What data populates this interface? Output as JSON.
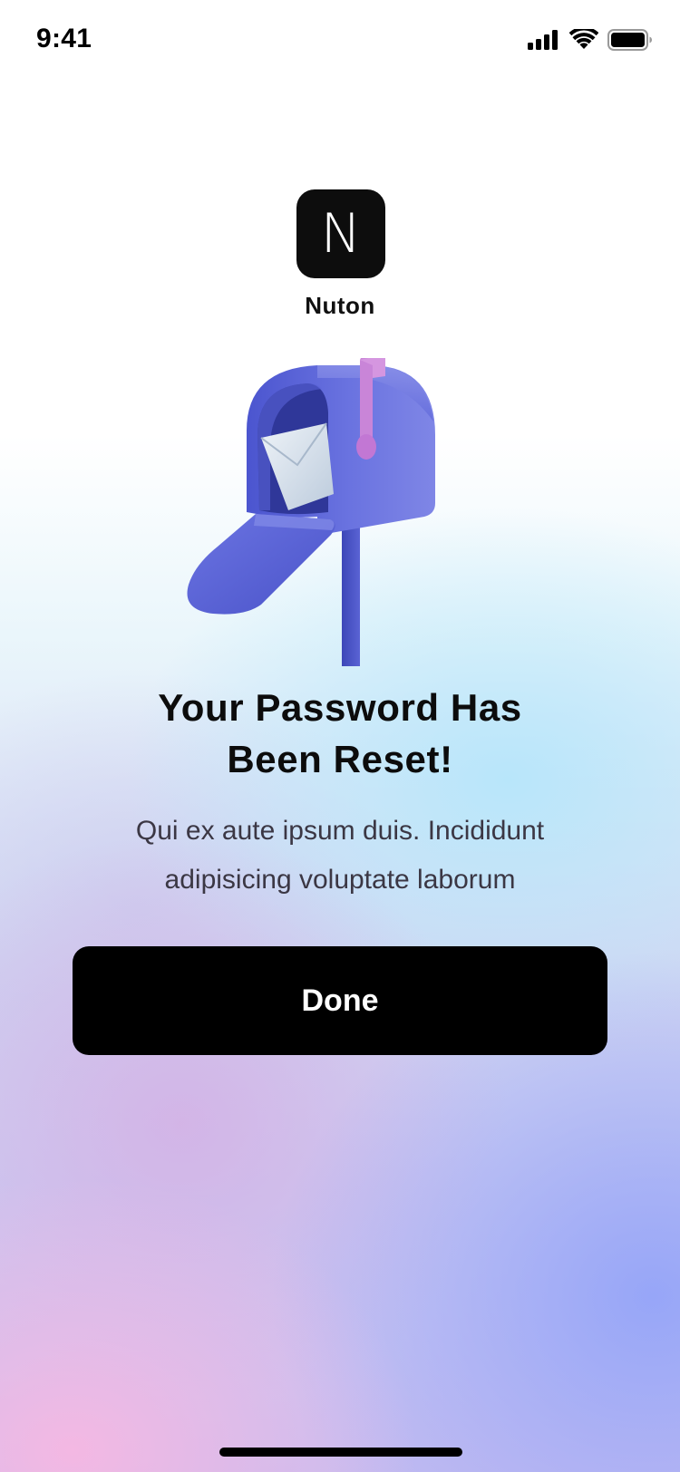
{
  "status_bar": {
    "time": "9:41",
    "icons": [
      "cellular-signal-icon",
      "wifi-icon",
      "battery-icon"
    ]
  },
  "app": {
    "logo_letter": "N",
    "name": "Nuton"
  },
  "illustration": {
    "name": "mailbox-illustration",
    "colors": {
      "mailbox": "#5a63d8",
      "flag": "#c884d8",
      "envelope": "#d8e4ee"
    }
  },
  "content": {
    "title_line1": "Your Password Has",
    "title_line2": "Been Reset!",
    "description_line1": "Qui ex aute ipsum duis. Incididunt",
    "description_line2": "adipisicing voluptate laborum"
  },
  "actions": {
    "done_label": "Done"
  },
  "colors": {
    "button_bg": "#000000",
    "button_text": "#ffffff",
    "gradient_pink": "#f6b8e2",
    "gradient_blue": "#94a4f8",
    "gradient_cyan": "#b6e6fa"
  }
}
